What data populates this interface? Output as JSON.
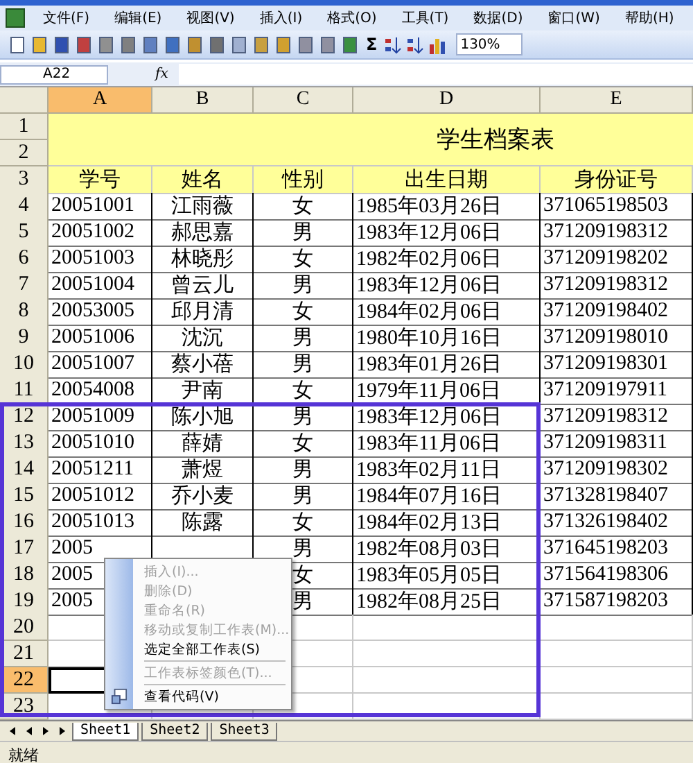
{
  "menu_bar": [
    "文件(F)",
    "编辑(E)",
    "视图(V)",
    "插入(I)",
    "格式(O)",
    "工具(T)",
    "数据(D)",
    "窗口(W)",
    "帮助(H)"
  ],
  "toolbar": {
    "autosum": "Σ",
    "zoom": "130%"
  },
  "formula_bar": {
    "name_box": "A22",
    "fx": "fx"
  },
  "columns": [
    {
      "label": "A",
      "selected": true
    },
    {
      "label": "B",
      "selected": false
    },
    {
      "label": "C",
      "selected": false
    },
    {
      "label": "D",
      "selected": false
    },
    {
      "label": "E",
      "selected": false
    }
  ],
  "title": "学生档案表",
  "header": [
    "学号",
    "姓名",
    "性别",
    "出生日期",
    "身份证号"
  ],
  "rows": [
    {
      "number": "4",
      "selected": false,
      "cells": [
        "20051001",
        "江雨薇",
        "女",
        "1985年03月26日",
        "371065198503"
      ]
    },
    {
      "number": "5",
      "selected": false,
      "cells": [
        "20051002",
        "郝思嘉",
        "男",
        "1983年12月06日",
        "371209198312"
      ]
    },
    {
      "number": "6",
      "selected": false,
      "cells": [
        "20051003",
        "林晓彤",
        "女",
        "1982年02月06日",
        "371209198202"
      ]
    },
    {
      "number": "7",
      "selected": false,
      "cells": [
        "20051004",
        "曾云儿",
        "男",
        "1983年12月06日",
        "371209198312"
      ]
    },
    {
      "number": "8",
      "selected": false,
      "cells": [
        "20053005",
        "邱月清",
        "女",
        "1984年02月06日",
        "371209198402"
      ]
    },
    {
      "number": "9",
      "selected": false,
      "cells": [
        "20051006",
        "沈沉",
        "男",
        "1980年10月16日",
        "371209198010"
      ]
    },
    {
      "number": "10",
      "selected": false,
      "cells": [
        "20051007",
        "蔡小蓓",
        "男",
        "1983年01月26日",
        "371209198301"
      ]
    },
    {
      "number": "11",
      "selected": false,
      "cells": [
        "20054008",
        "尹南",
        "女",
        "1979年11月06日",
        "371209197911"
      ]
    },
    {
      "number": "12",
      "selected": false,
      "cells": [
        "20051009",
        "陈小旭",
        "男",
        "1983年12月06日",
        "371209198312"
      ]
    },
    {
      "number": "13",
      "selected": false,
      "cells": [
        "20051010",
        "薛婧",
        "女",
        "1983年11月06日",
        "371209198311"
      ]
    },
    {
      "number": "14",
      "selected": false,
      "cells": [
        "20051211",
        "萧煜",
        "男",
        "1983年02月11日",
        "371209198302"
      ]
    },
    {
      "number": "15",
      "selected": false,
      "cells": [
        "20051012",
        "乔小麦",
        "男",
        "1984年07月16日",
        "371328198407"
      ]
    },
    {
      "number": "16",
      "selected": false,
      "cells": [
        "20051013",
        "陈露",
        "女",
        "1984年02月13日",
        "371326198402"
      ]
    },
    {
      "number": "17",
      "selected": false,
      "cells": [
        "2005",
        null,
        "男",
        "1982年08月03日",
        "371645198203"
      ]
    },
    {
      "number": "18",
      "selected": false,
      "cells": [
        "2005",
        null,
        "女",
        "1983年05月05日",
        "371564198306"
      ]
    },
    {
      "number": "19",
      "selected": false,
      "cells": [
        "2005",
        null,
        "男",
        "1982年08月25日",
        "371587198203"
      ]
    },
    {
      "number": "20",
      "selected": false,
      "cells": []
    },
    {
      "number": "21",
      "selected": false,
      "cells": []
    },
    {
      "number": "22",
      "selected": true,
      "cells": []
    },
    {
      "number": "23",
      "selected": false,
      "cells": []
    }
  ],
  "top_row_numbers": [
    "1",
    "2",
    "3"
  ],
  "context_menu": [
    {
      "kind": "item",
      "label": "插入(I)...",
      "disabled": true
    },
    {
      "kind": "item",
      "label": "删除(D)",
      "disabled": true
    },
    {
      "kind": "item",
      "label": "重命名(R)",
      "disabled": true
    },
    {
      "kind": "item",
      "label": "移动或复制工作表(M)...",
      "disabled": true
    },
    {
      "kind": "item",
      "label": "选定全部工作表(S)",
      "disabled": false
    },
    {
      "kind": "separator"
    },
    {
      "kind": "item",
      "label": "工作表标签颜色(T)...",
      "disabled": true
    },
    {
      "kind": "separator"
    },
    {
      "kind": "icon-item",
      "label": "查看代码(V)",
      "disabled": false
    }
  ],
  "sheet_tabs": [
    {
      "label": "Sheet1",
      "selected": true
    },
    {
      "label": "Sheet2",
      "selected": false
    },
    {
      "label": "Sheet3",
      "selected": false
    }
  ],
  "status_bar": "就绪"
}
